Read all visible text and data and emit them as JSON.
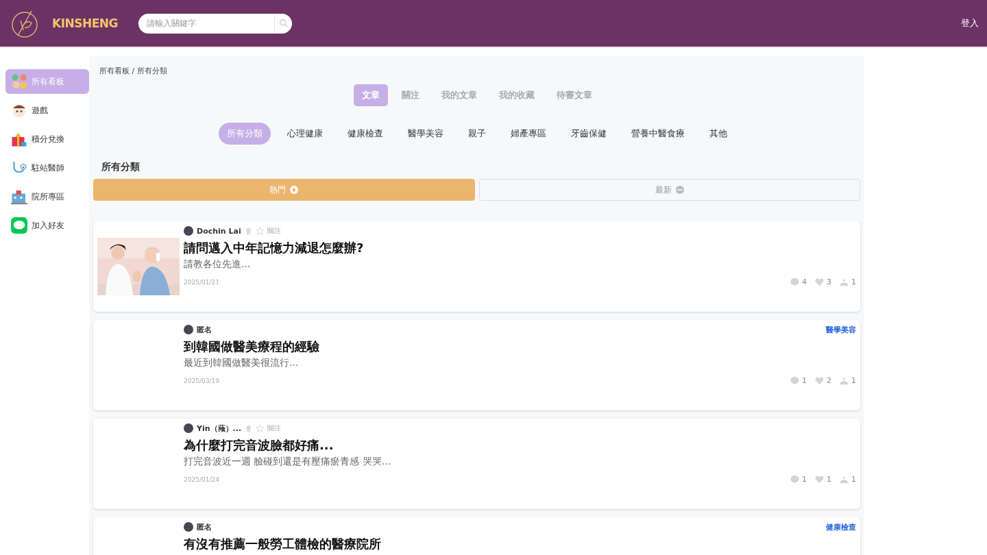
{
  "header": {
    "brand": "KINSHENG",
    "search": {
      "placeholder": "請輸入關鍵字"
    },
    "login": "登入"
  },
  "sidebar": {
    "items": [
      {
        "label": "所有看板",
        "selected": true
      },
      {
        "label": "遊戲",
        "selected": false
      },
      {
        "label": "積分兌換",
        "selected": false
      },
      {
        "label": "駐站醫師",
        "selected": false
      },
      {
        "label": "院所專區",
        "selected": false
      },
      {
        "label": "加入好友",
        "selected": false
      }
    ]
  },
  "breadcrumb": "所有看板 / 所有分類",
  "tabs": [
    {
      "label": "文章",
      "selected": true
    },
    {
      "label": "關注",
      "selected": false
    },
    {
      "label": "我的文章",
      "selected": false
    },
    {
      "label": "我的收藏",
      "selected": false
    },
    {
      "label": "待審文章",
      "selected": false
    }
  ],
  "categories": [
    {
      "label": "所有分類",
      "selected": true
    },
    {
      "label": "心理健康",
      "selected": false
    },
    {
      "label": "健康檢查",
      "selected": false
    },
    {
      "label": "醫學美容",
      "selected": false
    },
    {
      "label": "親子",
      "selected": false
    },
    {
      "label": "婦產專區",
      "selected": false
    },
    {
      "label": "牙齒保健",
      "selected": false
    },
    {
      "label": "營養中醫食療",
      "selected": false
    },
    {
      "label": "其他",
      "selected": false
    }
  ],
  "section_title": "所有分類",
  "sort": [
    {
      "label": "熱門",
      "kind": "hot",
      "selected": true
    },
    {
      "label": "最新",
      "kind": "new",
      "selected": false
    }
  ],
  "posts": [
    {
      "author": "Dochin Lai",
      "follow": "關注",
      "has_picture": true,
      "title": "請問邁入中年記憶力減退怎麼辦?",
      "excerpt": "請教各位先進...",
      "date": "2025/01/21",
      "comments": "4",
      "likes": "3",
      "count_3": "1"
    },
    {
      "author": "匿名",
      "category": "醫學美容",
      "has_picture": false,
      "title": "到韓國做醫美療程的經驗",
      "excerpt": "最近到韓國做醫美很流行...",
      "date": "2025/03/19",
      "comments": "1",
      "likes": "2",
      "count_3": "1"
    },
    {
      "author": "Yin（薞）...",
      "follow": "關注",
      "has_picture": false,
      "title": "為什麼打完音波臉都好痛...",
      "excerpt": "打完音波近一週 臉碰到還是有壓痛瘀青感 哭哭...",
      "date": "2025/01/24",
      "comments": "1",
      "likes": "1",
      "count_3": "1"
    },
    {
      "author": "匿名",
      "category": "健康檢查",
      "has_picture": false,
      "title": "有沒有推薦一般勞工體檢的醫療院所"
    }
  ]
}
